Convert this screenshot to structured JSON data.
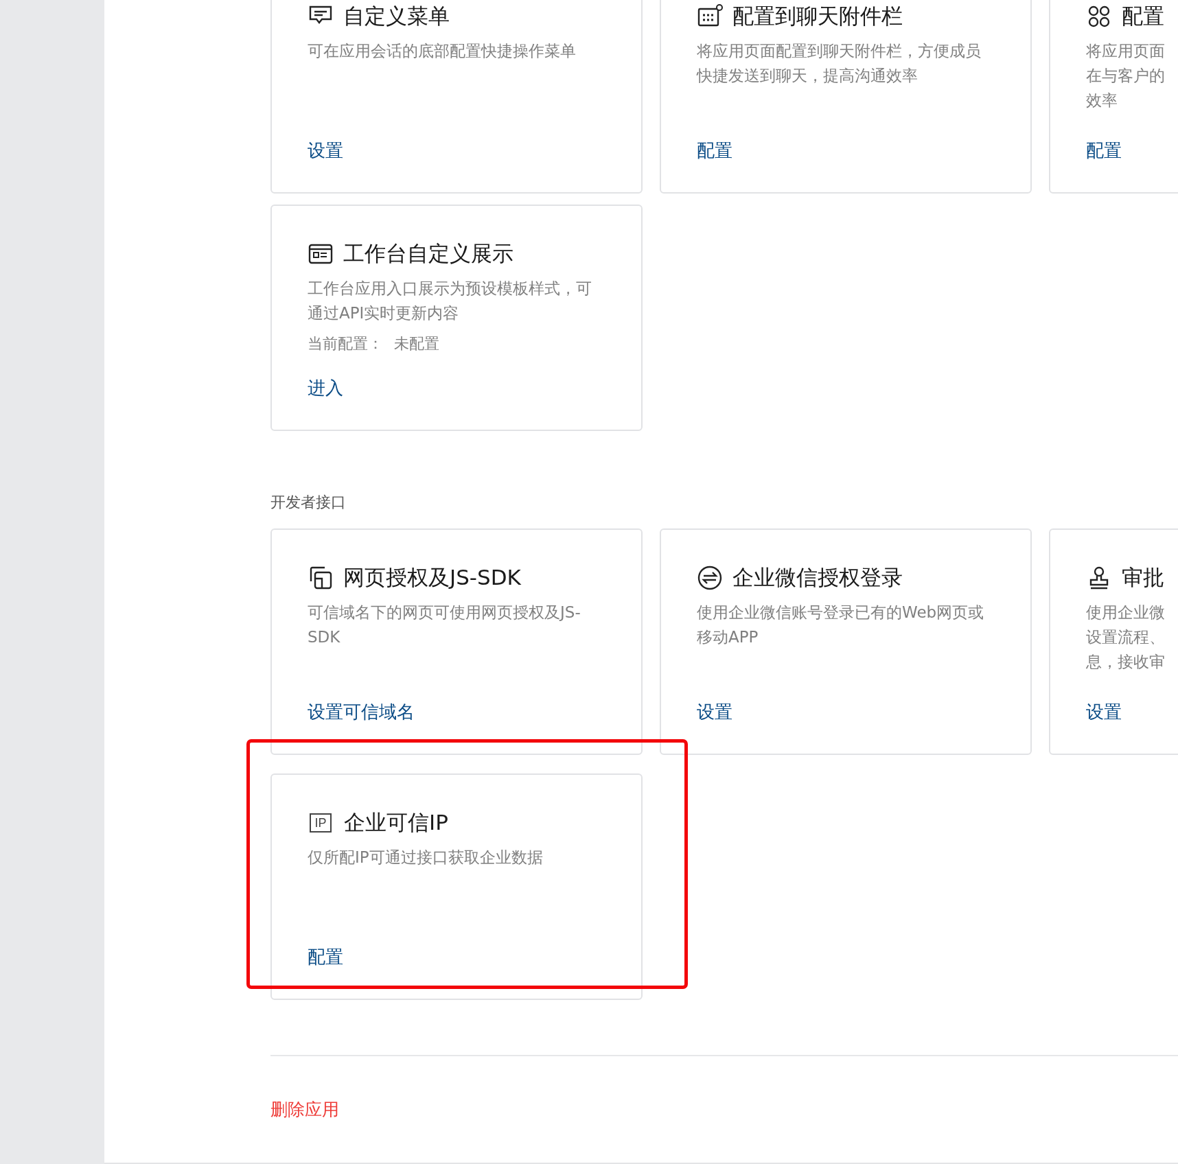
{
  "sections": [
    {
      "cards": [
        {
          "kind": "chat",
          "title": "自定义菜单",
          "description": [
            "可在应用会话的底部配置快捷操作菜单"
          ],
          "link": "设置",
          "highlighted": false
        },
        {
          "kind": "grid",
          "title": "配置到聊天附件栏",
          "description": [
            "将应用页面配置到聊天附件栏，方便成员",
            "快捷发送到聊天，提高沟通效率"
          ],
          "link": "配置",
          "highlighted": false
        },
        {
          "kind": "clover",
          "title": "配置",
          "description": [
            "将应用页面",
            "在与客户的",
            "效率"
          ],
          "link": "配置",
          "highlighted": false
        },
        {
          "kind": "window",
          "title": "工作台自定义展示",
          "description": [
            "工作台应用入口展示为预设模板样式，可",
            "通过API实时更新内容"
          ],
          "status": {
            "label": "当前配置：",
            "value": "未配置"
          },
          "link": "进入",
          "highlighted": false
        }
      ]
    },
    {
      "label": "开发者接口",
      "cards": [
        {
          "kind": "squares",
          "title": "网页授权及JS-SDK",
          "description": [
            "可信域名下的网页可使用网页授权及JS-",
            "SDK"
          ],
          "link": "设置可信域名",
          "highlighted": false
        },
        {
          "kind": "exchange",
          "title": "企业微信授权登录",
          "description": [
            "使用企业微信账号登录已有的Web网页或",
            "移动APP"
          ],
          "link": "设置",
          "highlighted": false
        },
        {
          "kind": "stamp",
          "title": "审批",
          "description": [
            "使用企业微",
            "设置流程、",
            "息，接收审"
          ],
          "link": "设置",
          "highlighted": false
        },
        {
          "kind": "badge",
          "icon_text": "IP",
          "title": "企业可信IP",
          "description": [
            "仅所配IP可通过接口获取企业数据"
          ],
          "link": "配置",
          "highlighted": true
        }
      ]
    }
  ],
  "delete_link": "删除应用"
}
